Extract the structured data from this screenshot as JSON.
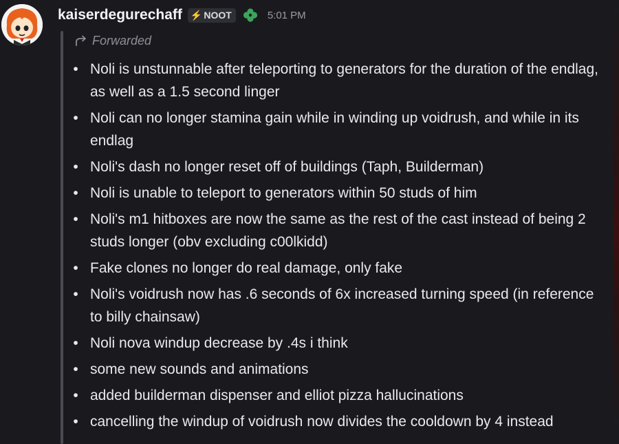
{
  "message": {
    "username": "kaiserdegurechaff",
    "tag": {
      "icon": "lightning-bolt-icon",
      "label": "NOOT"
    },
    "badge_icon": "green-clover-icon",
    "timestamp": "5:01 PM",
    "forwarded_label": "Forwarded",
    "bullet_glyph": "•",
    "items": [
      "Noli is unstunnable after teleporting to generators for the duration of the endlag, as well as a 1.5 second linger",
      "Noli can no longer stamina gain while in winding up voidrush, and while in its endlag",
      "Noli's dash no longer reset off of buildings (Taph, Builderman)",
      "Noli is unable to teleport to generators within 50 studs of him",
      "Noli's m1 hitboxes are now the same as the rest of the cast instead of being 2 studs longer (obv excluding c00lkidd)",
      "Fake clones no longer do real damage, only fake",
      "Noli's voidrush now has .6 seconds of 6x increased turning speed (in reference to billy chainsaw)",
      "Noli nova windup decrease by .4s i think",
      "some new sounds and animations",
      "added builderman dispenser and elliot pizza hallucinations",
      "cancelling the windup of voidrush now divides the cooldown by 4 instead"
    ]
  },
  "colors": {
    "background": "#1a1a1e",
    "text": "#e9e9ee",
    "username": "#f2f3f5",
    "muted": "#8d8e96",
    "tag_bg": "#2e2f35",
    "bolt": "#8f9cf5",
    "clover": "#3ba55c"
  }
}
